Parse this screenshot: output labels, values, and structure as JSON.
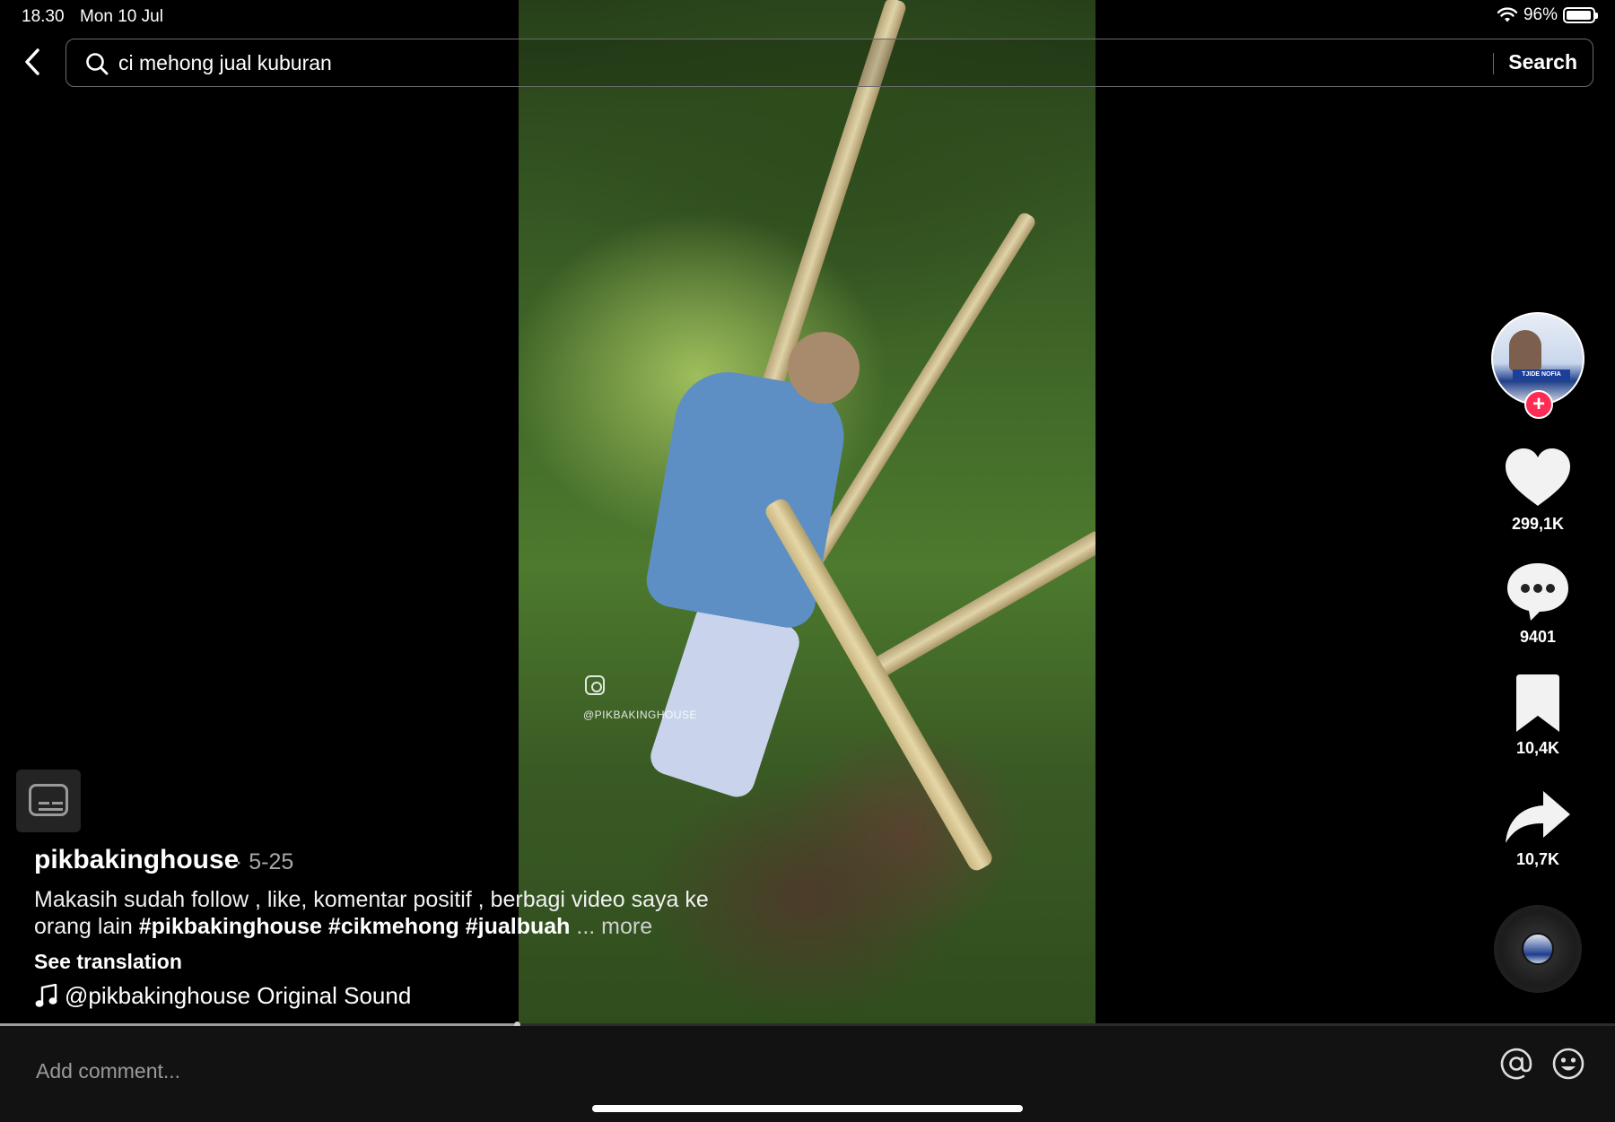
{
  "status_bar": {
    "time": "18.30",
    "date": "Mon 10 Jul",
    "battery": "96%",
    "battery_level": 0.96
  },
  "search": {
    "query": "ci mehong jual kuburan",
    "button_label": "Search"
  },
  "video": {
    "watermark": "@PIKBAKINGHOUSE",
    "progress": 0.32
  },
  "creator": {
    "avatar_banner": "TJIDE NOFIA"
  },
  "actions": {
    "likes": "299,1K",
    "comments": "9401",
    "saves": "10,4K",
    "shares": "10,7K"
  },
  "caption": {
    "author": "pikbakinghouse",
    "date": "· 5-25",
    "text": "Makasih sudah follow , like, komentar positif , berbagi video saya ke orang lain ",
    "hashtags": [
      "#pikbakinghouse",
      "#cikmehong",
      "#jualbuah"
    ],
    "more": "... more",
    "see_translation": "See translation",
    "sound": "@pikbakinghouse Original Sound"
  },
  "comment": {
    "placeholder": "Add comment..."
  },
  "colors": {
    "accent": "#fe2c55",
    "background": "#000000"
  }
}
